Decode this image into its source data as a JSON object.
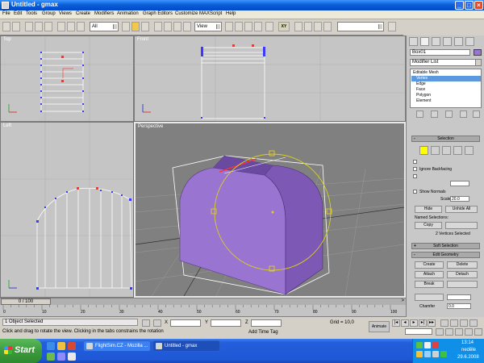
{
  "window": {
    "title": "Untitled - gmax"
  },
  "menu": [
    "File",
    "Edit",
    "Tools",
    "Group",
    "Views",
    "Create",
    "Modifiers",
    "Animation",
    "Graph Editors",
    "Customize",
    "MAXScript",
    "Help"
  ],
  "toolbar": {
    "selection_filter": "All",
    "ref_coord": "View",
    "axis_constraint": "XY"
  },
  "viewports": {
    "top": {
      "label": "Top"
    },
    "front": {
      "label": "Front"
    },
    "left": {
      "label": "Left"
    },
    "perspective": {
      "label": "Perspective"
    }
  },
  "command_panel": {
    "object_name": "Box01",
    "object_color": "#9a74d1",
    "modifier_list": "Modifier List",
    "stack": [
      {
        "label": "Editable Mesh",
        "level": 0,
        "selected": false
      },
      {
        "label": "Vertex",
        "level": 1,
        "selected": true
      },
      {
        "label": "Edge",
        "level": 1,
        "selected": false
      },
      {
        "label": "Face",
        "level": 1,
        "selected": false
      },
      {
        "label": "Polygon",
        "level": 1,
        "selected": false
      },
      {
        "label": "Element",
        "level": 1,
        "selected": false
      }
    ],
    "selection": {
      "title": "Selection",
      "ignore_backfacing": "Ignore Backfacing",
      "show_normals": "Show Normals",
      "scale_label": "Scale:",
      "scale_value": "20.0",
      "hide": "Hide",
      "unhide_all": "Unhide All",
      "named_selections": "Named Selections:",
      "copy": "Copy",
      "status": "2 Vertices Selected"
    },
    "soft_selection": {
      "title": "Soft Selection"
    },
    "edit_geometry": {
      "title": "Edit Geometry",
      "create": "Create",
      "delete": "Delete",
      "attach": "Attach",
      "detach": "Detach",
      "break": "Break",
      "chamfer": "Chamfer",
      "chamfer_value": "0.0"
    }
  },
  "time_slider": {
    "label": "0 / 100",
    "progress": 0
  },
  "track_ticks": [
    "0",
    "10",
    "20",
    "30",
    "40",
    "50",
    "60",
    "70",
    "80",
    "90",
    "100"
  ],
  "status": {
    "selection": "1 Object Selected",
    "prompt": "Click and drag to rotate the view.  Clicking in the tabs constrains the rotation",
    "time_tag": "Add Time Tag",
    "grid": "Grid = 10,0",
    "animate": "Animate"
  },
  "taskbar": {
    "start": "Start",
    "items": [
      {
        "label": "FlightSim.CZ - Mozilla ...",
        "active": false
      },
      {
        "label": "Untitled - gmax",
        "active": true
      }
    ],
    "clock": "13:14",
    "day": "neděle",
    "date": "29.6.2008"
  },
  "colors": {
    "object": "#9a74d1",
    "selected_vertex": "#ff3030",
    "gizmo": "#d8d020",
    "xp_blue": "#245edb"
  }
}
